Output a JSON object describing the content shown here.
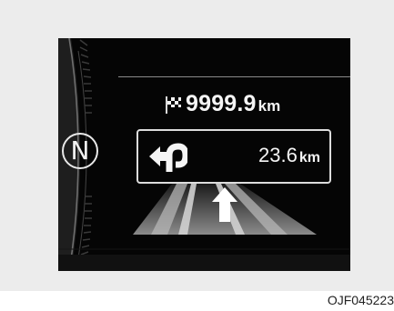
{
  "cluster": {
    "gear_indicator": "N",
    "total_distance": "9999.9",
    "total_distance_unit": "km",
    "turn_distance": "23.6",
    "turn_distance_unit": "km"
  },
  "icons": {
    "destination": "checkered-flag-icon",
    "maneuver": "u-turn-left-icon",
    "lane": "straight-arrow-icon"
  },
  "colors": {
    "display_bg": "#050505",
    "text": "#f5f5f5",
    "box_border": "#dcdcdc",
    "road": "#6f6f6f"
  },
  "caption": "OJF045223"
}
